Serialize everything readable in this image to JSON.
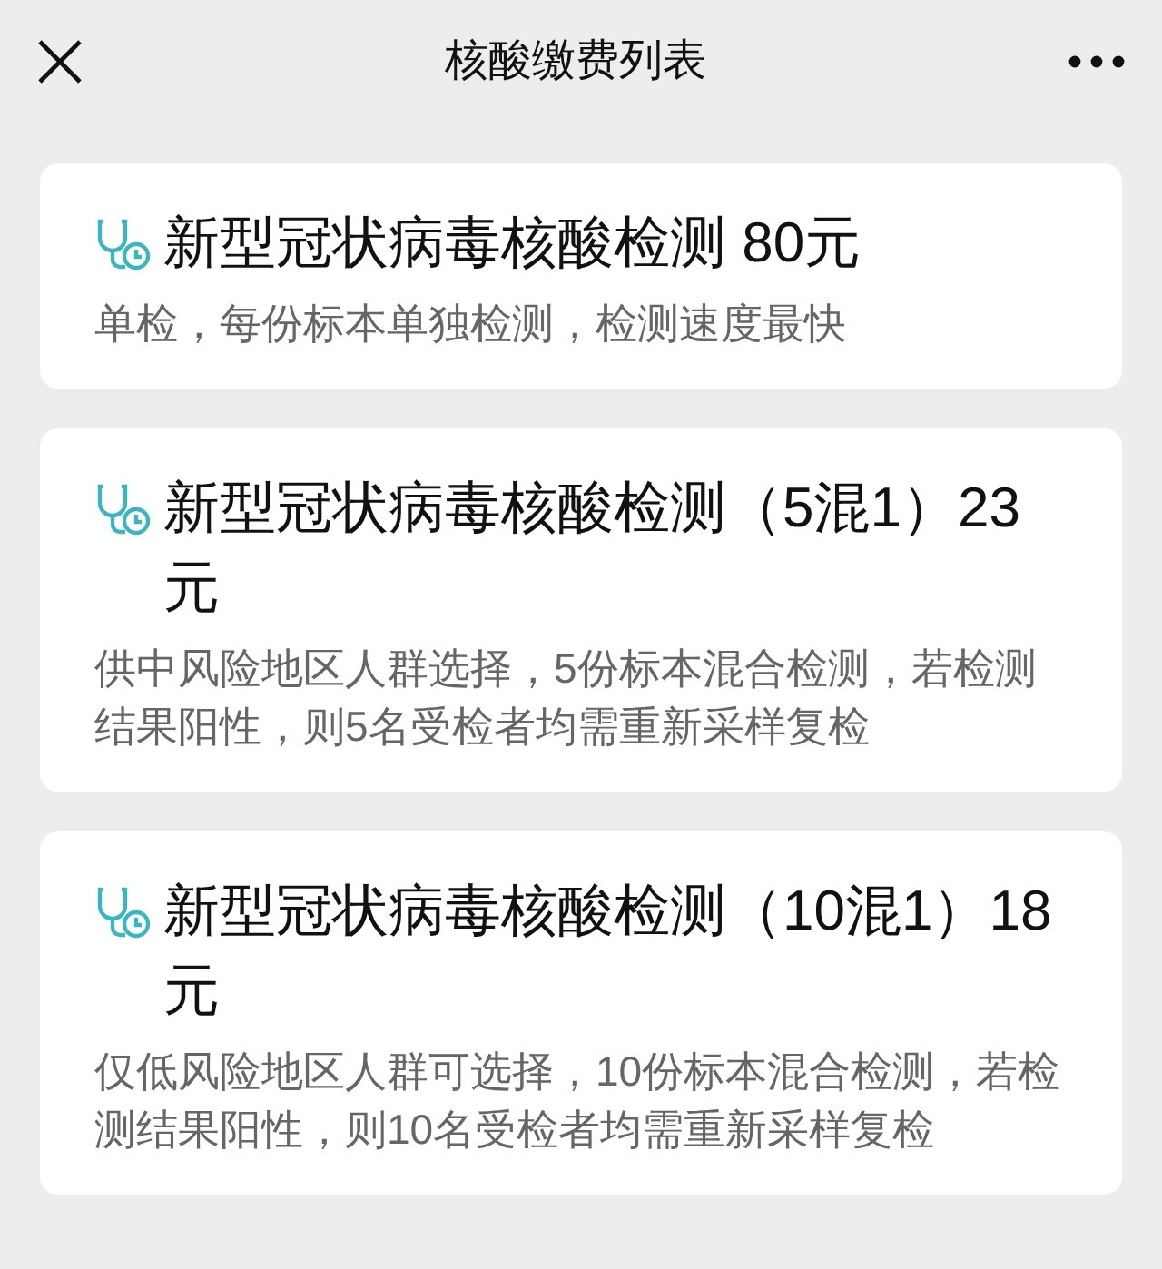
{
  "header": {
    "title": "核酸缴费列表"
  },
  "items": [
    {
      "title": "新型冠状病毒核酸检测 80元",
      "description": "单检，每份标本单独检测，检测速度最快"
    },
    {
      "title": "新型冠状病毒核酸检测（5混1）23元",
      "description": "供中风险地区人群选择，5份标本混合检测，若检测结果阳性，则5名受检者均需重新采样复检"
    },
    {
      "title": "新型冠状病毒核酸检测（10混1）18元",
      "description": "仅低风险地区人群可选择，10份标本混合检测，若检测结果阳性，则10名受检者均需重新采样复检"
    }
  ]
}
